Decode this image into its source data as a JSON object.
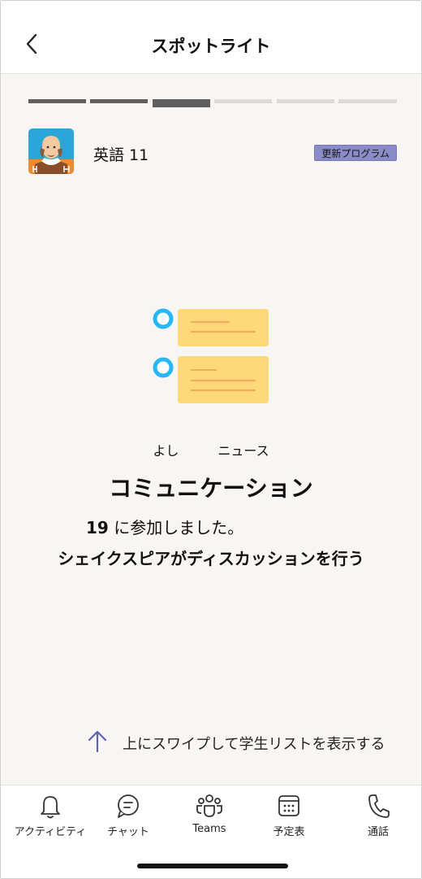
{
  "header": {
    "title": "スポットライト",
    "back_icon": "chevron-left-icon"
  },
  "progress": {
    "total_segments": 6,
    "current_segment": 3
  },
  "class": {
    "name": "英語 11",
    "badge": "更新プログラム",
    "avatar_icon": "shakespeare-avatar-icon"
  },
  "card": {
    "illustration_icon": "discussion-cards-icon",
    "category": "よし　　　ニュース",
    "title": "コミュニケーション",
    "joined_count": "19",
    "joined_text": "に参加しました。",
    "activity": "シェイクスピアがディスカッションを行う"
  },
  "swipe": {
    "label": "上にスワイプして学生リストを表示する",
    "icon": "arrow-up-icon"
  },
  "tabs": [
    {
      "label": "アクティビティ",
      "icon": "bell-icon"
    },
    {
      "label": "チャット",
      "icon": "chat-icon"
    },
    {
      "label": "Teams",
      "icon": "teams-icon"
    },
    {
      "label": "予定表",
      "icon": "calendar-icon"
    },
    {
      "label": "通話",
      "icon": "phone-icon"
    }
  ],
  "colors": {
    "accent": "#6264a7",
    "badge_bg": "#8b8cc7",
    "card_yellow": "#ffd978",
    "card_line": "#f2a95b",
    "bullet_blue": "#29b6f6",
    "progress_done": "#5f5f5f",
    "progress_todo": "#dcdad8"
  }
}
